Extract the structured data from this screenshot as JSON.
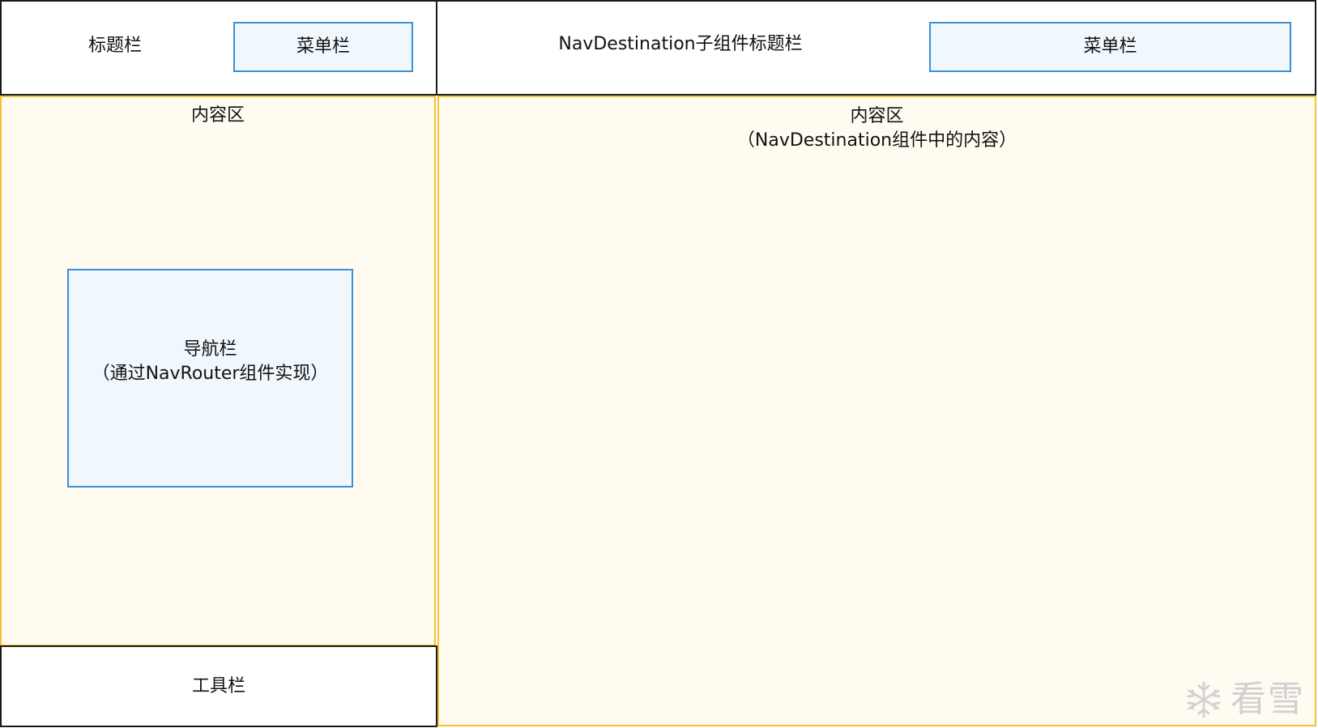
{
  "left_panel": {
    "title_bar_label": "标题栏",
    "menu_bar_label": "菜单栏",
    "content_label": "内容区",
    "nav_bar": {
      "line1": "导航栏",
      "line2": "（通过NavRouter组件实现）"
    },
    "toolbar_label": "工具栏"
  },
  "right_panel": {
    "title_bar_label": "NavDestination子组件标题栏",
    "menu_bar_label": "菜单栏",
    "content": {
      "line1": "内容区",
      "line2": "（NavDestination组件中的内容）"
    }
  },
  "watermark": {
    "icon": "snowflake-icon",
    "text": "看雪"
  },
  "colors": {
    "outline": "#1a1a1a",
    "content_border": "#f2c230",
    "content_fill": "#fffbf0",
    "menu_border": "#3a8fd6",
    "menu_fill": "#f0f8fe"
  }
}
